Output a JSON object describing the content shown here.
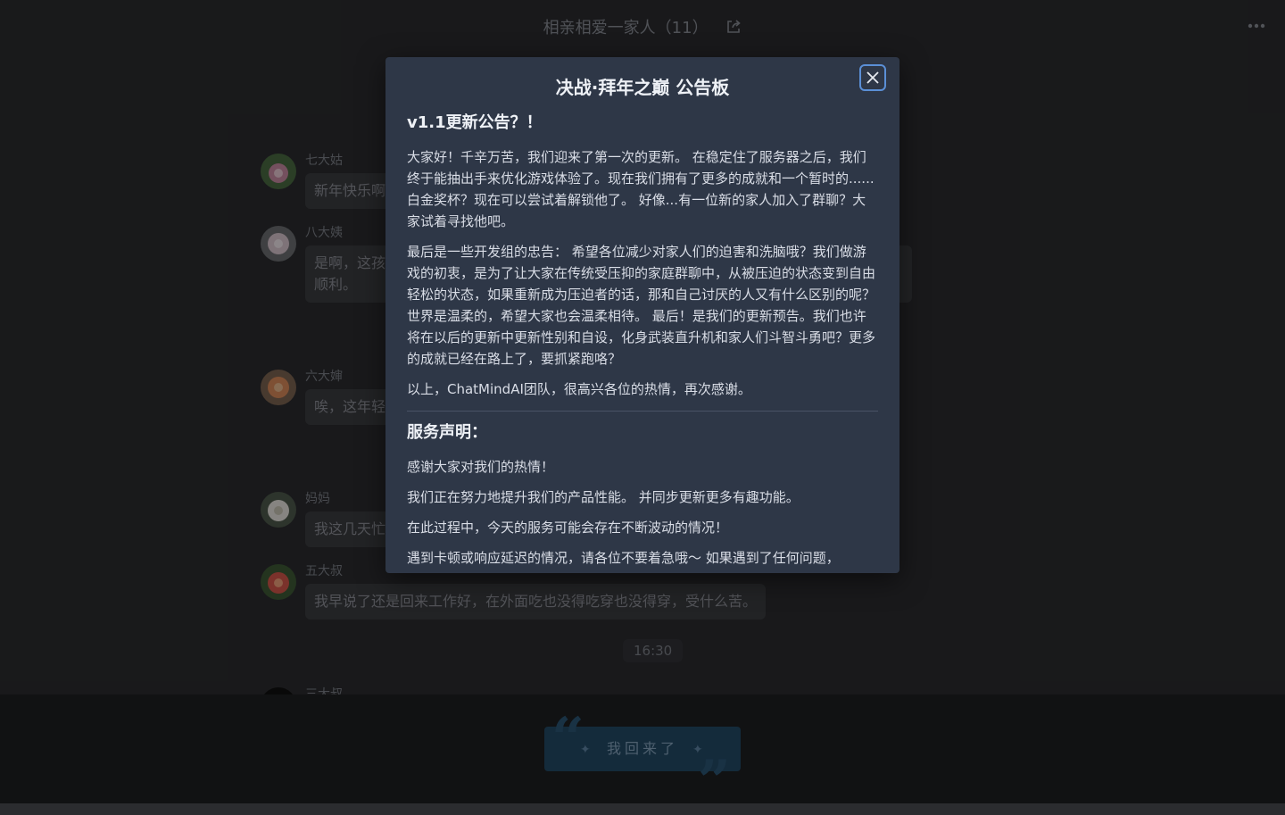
{
  "header": {
    "group_name": "相亲相爱一家人（11）"
  },
  "messages": [
    {
      "sender": "七大姑",
      "text": "新年快乐啊"
    },
    {
      "sender": "八大姨",
      "text_line1": "是啊，这孩",
      "text_line2": "顺利。"
    },
    {
      "sender": "六大婶",
      "text": "唉，这年轻"
    },
    {
      "sender": "妈妈",
      "text": "我这几天忙"
    },
    {
      "sender": "五大叔",
      "text": "我早说了还是回来工作好，在外面吃也没得吃穿也没得穿，受什么苦。"
    },
    {
      "sender": "三大叔"
    }
  ],
  "time_divider": "16:30",
  "bottom_button": {
    "label": "我回来了"
  },
  "modal": {
    "title": "决战·拜年之巅 公告板",
    "update_heading": "v1.1更新公告？！",
    "update_paragraphs": [
      "大家好！千辛万苦，我们迎来了第一次的更新。 在稳定住了服务器之后，我们终于能抽出手来优化游戏体验了。现在我们拥有了更多的成就和一个暂时的......白金奖杯？现在可以尝试着解锁他了。 好像...有一位新的家人加入了群聊？大家试着寻找他吧。",
      "最后是一些开发组的忠告： 希望各位减少对家人们的迫害和洗脑哦？我们做游戏的初衷，是为了让大家在传统受压抑的家庭群聊中，从被压迫的状态变到自由轻松的状态，如果重新成为压迫者的话，那和自己讨厌的人又有什么区别的呢？ 世界是温柔的，希望大家也会温柔相待。 最后！是我们的更新预告。我们也许将在以后的更新中更新性别和自设，化身武装直升机和家人们斗智斗勇吧？更多的成就已经在路上了，要抓紧跑咯？",
      "以上，ChatMindAI团队，很高兴各位的热情，再次感谢。"
    ],
    "service_heading": "服务声明：",
    "service_paragraphs": [
      "感谢大家对我们的热情！",
      "我们正在努力地提升我们的产品性能。 并同步更新更多有趣功能。",
      "在此过程中，今天的服务可能会存在不断波动的情况！",
      "遇到卡顿或响应延迟的情况，请各位不要着急哦～ 如果遇到了任何问题，"
    ]
  }
}
